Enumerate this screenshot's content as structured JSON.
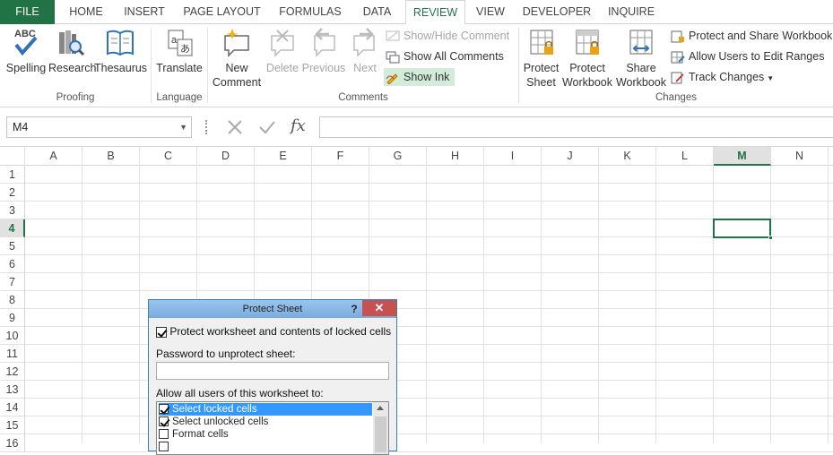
{
  "tabs": [
    "FILE",
    "HOME",
    "INSERT",
    "PAGE LAYOUT",
    "FORMULAS",
    "DATA",
    "REVIEW",
    "VIEW",
    "DEVELOPER",
    "INQUIRE"
  ],
  "active_tab": "REVIEW",
  "accent": "#217346",
  "ribbon": {
    "proofing": {
      "label": "Proofing",
      "spelling": "Spelling",
      "research": "Research",
      "thesaurus": "Thesaurus"
    },
    "language": {
      "label": "Language",
      "translate": "Translate"
    },
    "comments": {
      "label": "Comments",
      "new1": "New",
      "new2": "Comment",
      "delete": "Delete",
      "previous": "Previous",
      "next": "Next",
      "show_hide": "Show/Hide Comment",
      "show_all": "Show All Comments",
      "show_ink": "Show Ink"
    },
    "changes": {
      "label": "Changes",
      "protect_sheet1": "Protect",
      "protect_sheet2": "Sheet",
      "protect_wb1": "Protect",
      "protect_wb2": "Workbook",
      "share_wb1": "Share",
      "share_wb2": "Workbook",
      "protect_share": "Protect and Share Workbook",
      "allow_edit": "Allow Users to Edit Ranges",
      "track": "Track Changes"
    }
  },
  "formula_bar": {
    "name_box": "M4",
    "fx": "fx",
    "formula": ""
  },
  "columns": [
    "A",
    "B",
    "C",
    "D",
    "E",
    "F",
    "G",
    "H",
    "I",
    "J",
    "K",
    "L",
    "M",
    "N"
  ],
  "rows": [
    "1",
    "2",
    "3",
    "4",
    "5",
    "6",
    "7",
    "8",
    "9",
    "10",
    "11",
    "12",
    "13",
    "14",
    "15",
    "16"
  ],
  "selected": {
    "col": "M",
    "row": "4"
  },
  "dialog": {
    "title": "Protect Sheet",
    "help": "?",
    "close": "✕",
    "protect_label": "Protect worksheet and contents of locked cells",
    "password_label": "Password to unprotect sheet:",
    "password_value": "",
    "allow_label": "Allow all users of this worksheet to:",
    "options": [
      {
        "label": "Select locked cells",
        "checked": true
      },
      {
        "label": "Select unlocked cells",
        "checked": true
      },
      {
        "label": "Format cells",
        "checked": false
      },
      {
        "label": "",
        "checked": false
      }
    ]
  }
}
